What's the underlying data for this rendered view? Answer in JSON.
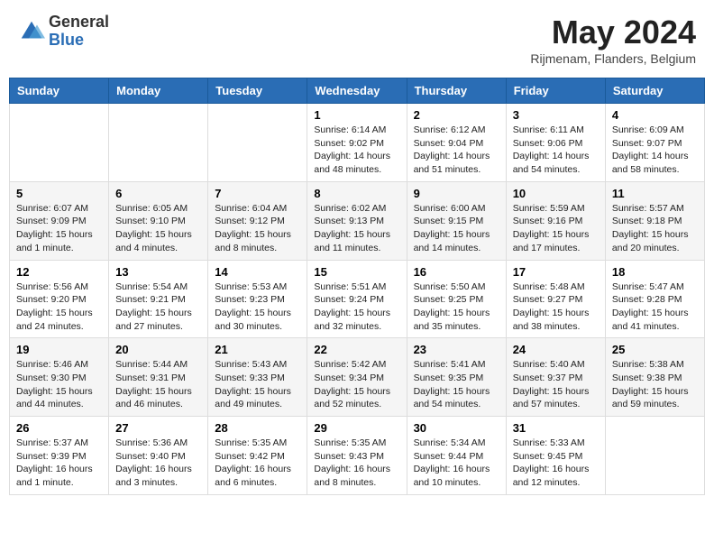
{
  "header": {
    "logo_general": "General",
    "logo_blue": "Blue",
    "month_title": "May 2024",
    "subtitle": "Rijmenam, Flanders, Belgium"
  },
  "days_of_week": [
    "Sunday",
    "Monday",
    "Tuesday",
    "Wednesday",
    "Thursday",
    "Friday",
    "Saturday"
  ],
  "weeks": [
    [
      {
        "day": "",
        "info": ""
      },
      {
        "day": "",
        "info": ""
      },
      {
        "day": "",
        "info": ""
      },
      {
        "day": "1",
        "info": "Sunrise: 6:14 AM\nSunset: 9:02 PM\nDaylight: 14 hours\nand 48 minutes."
      },
      {
        "day": "2",
        "info": "Sunrise: 6:12 AM\nSunset: 9:04 PM\nDaylight: 14 hours\nand 51 minutes."
      },
      {
        "day": "3",
        "info": "Sunrise: 6:11 AM\nSunset: 9:06 PM\nDaylight: 14 hours\nand 54 minutes."
      },
      {
        "day": "4",
        "info": "Sunrise: 6:09 AM\nSunset: 9:07 PM\nDaylight: 14 hours\nand 58 minutes."
      }
    ],
    [
      {
        "day": "5",
        "info": "Sunrise: 6:07 AM\nSunset: 9:09 PM\nDaylight: 15 hours\nand 1 minute."
      },
      {
        "day": "6",
        "info": "Sunrise: 6:05 AM\nSunset: 9:10 PM\nDaylight: 15 hours\nand 4 minutes."
      },
      {
        "day": "7",
        "info": "Sunrise: 6:04 AM\nSunset: 9:12 PM\nDaylight: 15 hours\nand 8 minutes."
      },
      {
        "day": "8",
        "info": "Sunrise: 6:02 AM\nSunset: 9:13 PM\nDaylight: 15 hours\nand 11 minutes."
      },
      {
        "day": "9",
        "info": "Sunrise: 6:00 AM\nSunset: 9:15 PM\nDaylight: 15 hours\nand 14 minutes."
      },
      {
        "day": "10",
        "info": "Sunrise: 5:59 AM\nSunset: 9:16 PM\nDaylight: 15 hours\nand 17 minutes."
      },
      {
        "day": "11",
        "info": "Sunrise: 5:57 AM\nSunset: 9:18 PM\nDaylight: 15 hours\nand 20 minutes."
      }
    ],
    [
      {
        "day": "12",
        "info": "Sunrise: 5:56 AM\nSunset: 9:20 PM\nDaylight: 15 hours\nand 24 minutes."
      },
      {
        "day": "13",
        "info": "Sunrise: 5:54 AM\nSunset: 9:21 PM\nDaylight: 15 hours\nand 27 minutes."
      },
      {
        "day": "14",
        "info": "Sunrise: 5:53 AM\nSunset: 9:23 PM\nDaylight: 15 hours\nand 30 minutes."
      },
      {
        "day": "15",
        "info": "Sunrise: 5:51 AM\nSunset: 9:24 PM\nDaylight: 15 hours\nand 32 minutes."
      },
      {
        "day": "16",
        "info": "Sunrise: 5:50 AM\nSunset: 9:25 PM\nDaylight: 15 hours\nand 35 minutes."
      },
      {
        "day": "17",
        "info": "Sunrise: 5:48 AM\nSunset: 9:27 PM\nDaylight: 15 hours\nand 38 minutes."
      },
      {
        "day": "18",
        "info": "Sunrise: 5:47 AM\nSunset: 9:28 PM\nDaylight: 15 hours\nand 41 minutes."
      }
    ],
    [
      {
        "day": "19",
        "info": "Sunrise: 5:46 AM\nSunset: 9:30 PM\nDaylight: 15 hours\nand 44 minutes."
      },
      {
        "day": "20",
        "info": "Sunrise: 5:44 AM\nSunset: 9:31 PM\nDaylight: 15 hours\nand 46 minutes."
      },
      {
        "day": "21",
        "info": "Sunrise: 5:43 AM\nSunset: 9:33 PM\nDaylight: 15 hours\nand 49 minutes."
      },
      {
        "day": "22",
        "info": "Sunrise: 5:42 AM\nSunset: 9:34 PM\nDaylight: 15 hours\nand 52 minutes."
      },
      {
        "day": "23",
        "info": "Sunrise: 5:41 AM\nSunset: 9:35 PM\nDaylight: 15 hours\nand 54 minutes."
      },
      {
        "day": "24",
        "info": "Sunrise: 5:40 AM\nSunset: 9:37 PM\nDaylight: 15 hours\nand 57 minutes."
      },
      {
        "day": "25",
        "info": "Sunrise: 5:38 AM\nSunset: 9:38 PM\nDaylight: 15 hours\nand 59 minutes."
      }
    ],
    [
      {
        "day": "26",
        "info": "Sunrise: 5:37 AM\nSunset: 9:39 PM\nDaylight: 16 hours\nand 1 minute."
      },
      {
        "day": "27",
        "info": "Sunrise: 5:36 AM\nSunset: 9:40 PM\nDaylight: 16 hours\nand 3 minutes."
      },
      {
        "day": "28",
        "info": "Sunrise: 5:35 AM\nSunset: 9:42 PM\nDaylight: 16 hours\nand 6 minutes."
      },
      {
        "day": "29",
        "info": "Sunrise: 5:35 AM\nSunset: 9:43 PM\nDaylight: 16 hours\nand 8 minutes."
      },
      {
        "day": "30",
        "info": "Sunrise: 5:34 AM\nSunset: 9:44 PM\nDaylight: 16 hours\nand 10 minutes."
      },
      {
        "day": "31",
        "info": "Sunrise: 5:33 AM\nSunset: 9:45 PM\nDaylight: 16 hours\nand 12 minutes."
      },
      {
        "day": "",
        "info": ""
      }
    ]
  ]
}
